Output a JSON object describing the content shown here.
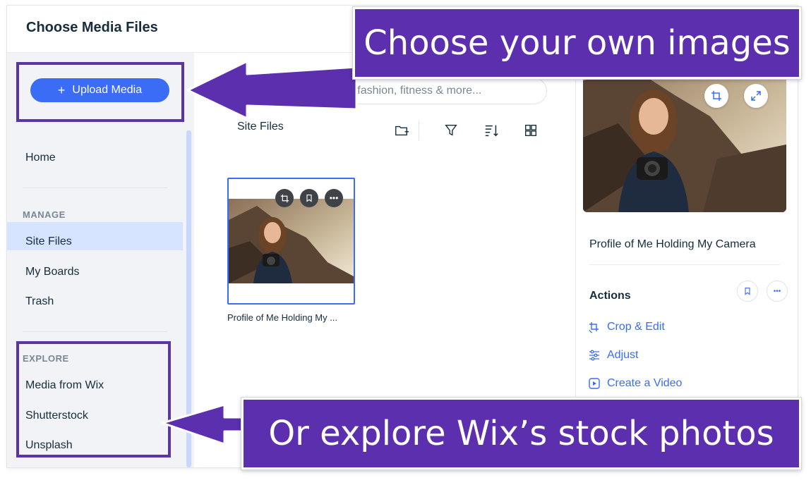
{
  "window": {
    "title": "Choose Media Files"
  },
  "sidebar": {
    "upload_label": "Upload Media",
    "home": "Home",
    "manage_heading": "MANAGE",
    "manage_items": [
      "Site Files",
      "My Boards",
      "Trash"
    ],
    "explore_heading": "EXPLORE",
    "explore_items": [
      "Media from Wix",
      "Shutterstock",
      "Unsplash"
    ]
  },
  "main": {
    "search_placeholder": "Search for business, fashion, fitness & more...",
    "breadcrumb": "Site Files",
    "file": {
      "caption": "Profile of Me Holding My ..."
    }
  },
  "details": {
    "name": "Profile of Me Holding My Camera",
    "actions_title": "Actions",
    "actions": [
      "Crop & Edit",
      "Adjust",
      "Create a Video"
    ]
  },
  "annotations": {
    "top_banner": "Choose your own images",
    "bottom_banner": "Or explore Wix’s stock photos"
  },
  "colors": {
    "accent": "#3b6cf5",
    "banner": "#5b2fad",
    "active_nav": "#d6e4ff"
  }
}
